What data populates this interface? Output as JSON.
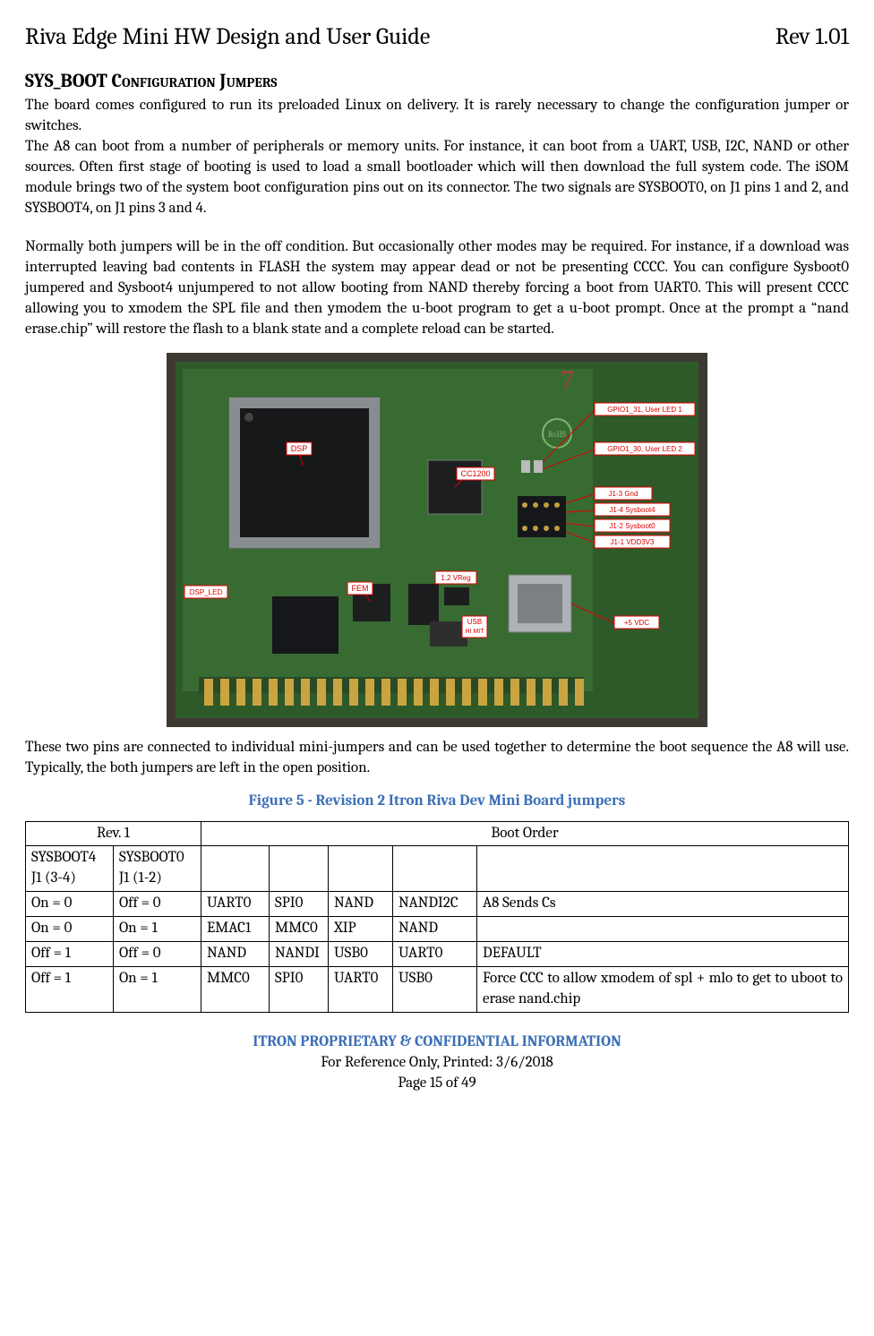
{
  "header": {
    "title": "Riva Edge Mini HW Design and User Guide",
    "revision": "Rev 1.01"
  },
  "section": {
    "heading": "SYS_BOOT Configuration Jumpers",
    "para1": "The board comes configured to run its preloaded Linux on delivery. It is rarely necessary to change the configuration jumper or switches.",
    "para2": "The A8 can boot from a number of peripherals or memory units. For instance, it can boot from a UART, USB, I2C, NAND or other sources. Often first stage of booting is used to load a small bootloader which will then download the full system code. The iSOM module brings two of the system boot configuration pins out on its connector. The two signals are SYSBOOT0, on J1 pins 1 and 2, and SYSBOOT4, on J1 pins 3 and 4.",
    "para3": "Normally both jumpers will be in the off condition. But occasionally other modes may be required. For instance, if a download was interrupted leaving bad contents in FLASH the system may appear dead or not be presenting CCCC. You can configure Sysboot0 jumpered and Sysboot4 unjumpered to not allow booting from NAND thereby forcing a boot from UART0. This will present CCCC allowing you to xmodem the SPL file and then ymodem the u-boot program to get a u-boot prompt. Once at the prompt a “nand erase.chip” will restore the flash to a blank state and a complete reload can be started.",
    "para4": "These two pins are connected to individual mini-jumpers and can be used together to determine the boot sequence the A8 will use. Typically, the both jumpers are left in the open position."
  },
  "figure": {
    "caption": "Figure 5 - Revision 2 Itron Riva Dev Mini Board jumpers",
    "labels": {
      "dsp": "DSP",
      "cc1200": "CC1200",
      "dsp_led": "DSP_LED",
      "fem": "FEM",
      "vreg": "1.2 VReg",
      "usb": "USB",
      "usb2": "HI MIT",
      "rohs": "RoHS",
      "gpio1_31": "GPIO1_31, User LED 1",
      "gpio1_30": "GPIO1_30, User LED 2",
      "j1_3": "J1-3 Gnd",
      "j1_4": "J1-4 Sysboot4",
      "j1_2": "J1-2 Sysboot0",
      "j1_1": "J1-1 VDD3V3",
      "5vdc": "+5 VDC",
      "seven": "7"
    }
  },
  "table": {
    "col_rev": "Rev. 1",
    "col_boot": "Boot Order",
    "h1": "SYSBOOT4 J1 (3-4)",
    "h2": "SYSBOOT0 J1 (1-2)",
    "rows": [
      {
        "a": "On = 0",
        "b": "Off = 0",
        "c": "UART0",
        "d": "SPI0",
        "e": "NAND",
        "f": "NANDI2C",
        "g": "A8 Sends Cs"
      },
      {
        "a": "On = 0",
        "b": "On = 1",
        "c": "EMAC1",
        "d": "MMC0",
        "e": "XIP",
        "f": "NAND",
        "g": ""
      },
      {
        "a": "Off = 1",
        "b": "Off = 0",
        "c": "NAND",
        "d": "NANDI",
        "e": "USB0",
        "f": "UART0",
        "g": "DEFAULT"
      },
      {
        "a": "Off = 1",
        "b": "On = 1",
        "c": "MMC0",
        "d": "SPI0",
        "e": "UART0",
        "f": "USB0",
        "g": "Force CCC to allow xmodem of spl + mlo to get to uboot to erase nand.chip"
      }
    ]
  },
  "footer": {
    "line1": "ITRON PROPRIETARY & CONFIDENTIAL INFORMATION",
    "line2": "For Reference Only, Printed: 3/6/2018",
    "line3": "Page 15 of 49"
  }
}
